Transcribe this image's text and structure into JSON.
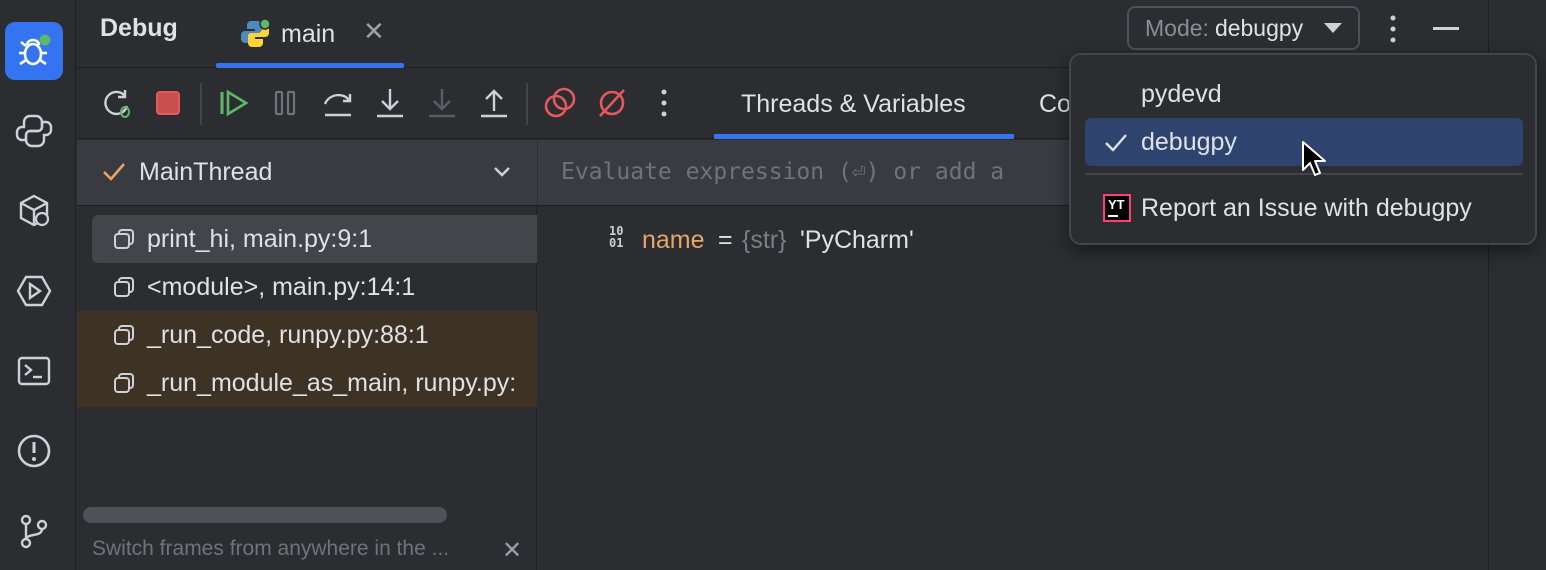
{
  "header": {
    "title": "Debug",
    "tab_label": "main",
    "tab_close": "✕",
    "mode_prefix": "Mode:",
    "mode_value": "debugpy"
  },
  "toolbar": {
    "tabs": [
      "Threads & Variables",
      "Co"
    ]
  },
  "frames": {
    "thread": "MainThread",
    "items": [
      "print_hi, main.py:9:1",
      "<module>, main.py:14:1",
      "_run_code, runpy.py:88:1",
      "_run_module_as_main, runpy.py:"
    ],
    "hint": "Switch frames from anywhere in the ...",
    "hint_close": "✕"
  },
  "variables": {
    "eval_placeholder": "Evaluate expression (⏎) or add a",
    "type_icon_line1": "10",
    "type_icon_line2": "01",
    "var_name": "name",
    "var_eq": "=",
    "var_type": "{str}",
    "var_value": "'PyCharm'"
  },
  "mode_menu": {
    "options": [
      "pydevd",
      "debugpy"
    ],
    "selected": "debugpy",
    "report": "Report an Issue with debugpy",
    "report_icon_text": "YT"
  },
  "colors": {
    "accent": "#3574f0",
    "selection": "#2e436e",
    "run_green": "#5fb865",
    "stop_red": "#e55b5b",
    "breakpoint_red": "#e5585e",
    "variable_orange": "#e8a56a"
  }
}
